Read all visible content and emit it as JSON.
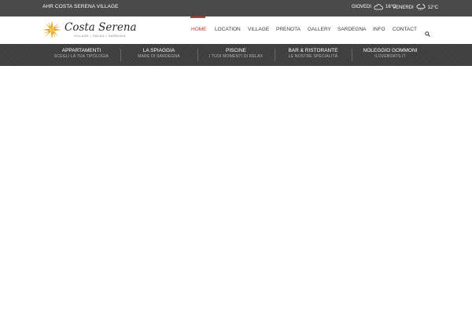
{
  "topbar": {
    "brand_line": "AHR COSTA SERENA VILLAGE",
    "weather": [
      {
        "day": "GIOVEDI",
        "temp": "16°C",
        "icon": "cloud-icon"
      },
      {
        "day": "VENERDI",
        "temp": "12°C",
        "icon": "rain-cloud-icon"
      }
    ]
  },
  "header": {
    "logo": {
      "name": "Costa Serena",
      "subtitle": "VILLAGE • PALAU • SARDINIA"
    },
    "nav": [
      {
        "label": "HOME",
        "active": true
      },
      {
        "label": "LOCATION"
      },
      {
        "label": "VILLAGE"
      },
      {
        "label": "PRENOTA"
      },
      {
        "label": "GALLERY"
      },
      {
        "label": "SARDEGNA"
      },
      {
        "label": "INFO"
      },
      {
        "label": "CONTACT"
      }
    ],
    "search_icon": "search-icon"
  },
  "subnav": [
    {
      "title": "APPARTAMENTI",
      "subtitle": "SCEGLI LA TUA TIPOLOGIA"
    },
    {
      "title": "LA SPIAGGIA",
      "subtitle": "MARE DI SARDEGNA"
    },
    {
      "title": "PISCINE",
      "subtitle": "I TUOI MOMENTI DI RELAX"
    },
    {
      "title": "BAR & RISTORANTE",
      "subtitle": "LE NOSTRE SPECIALITÀ"
    },
    {
      "title": "NOLEGGIO GOMMONI",
      "subtitle": "ILOVEBOATS.IT"
    }
  ],
  "colors": {
    "accent": "#c0392b",
    "topbar_bg": "#4a4a4a",
    "subnav_bg": "#3d3d3d",
    "logo_sun": "#e8a317"
  }
}
